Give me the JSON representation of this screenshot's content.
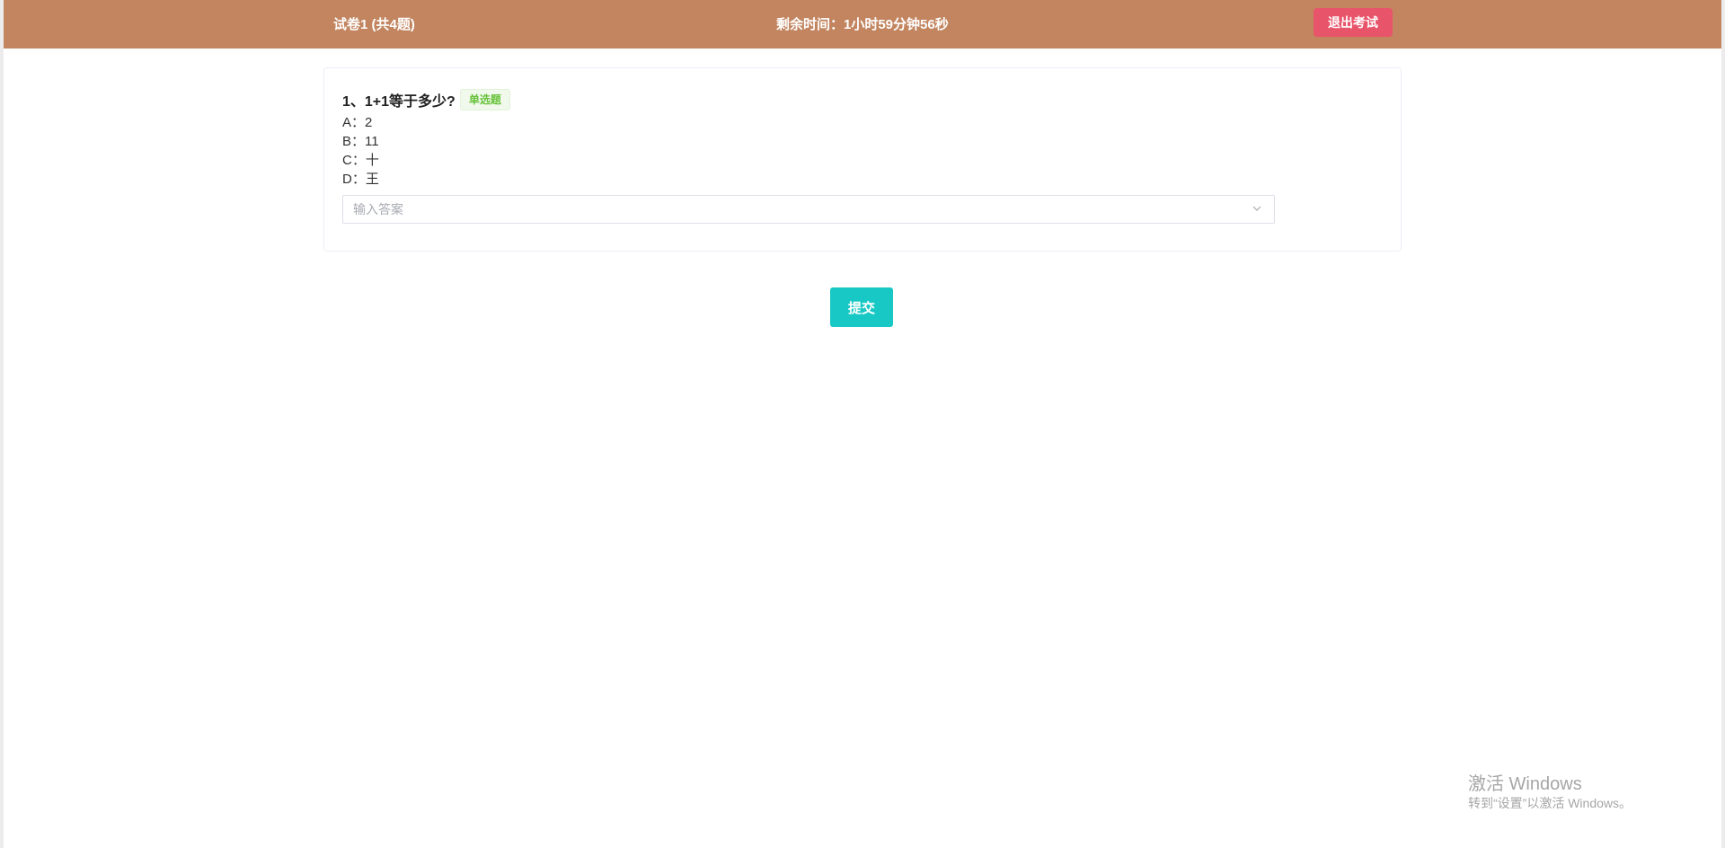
{
  "header": {
    "paper_title": "试卷1 (共4题)",
    "timer_text": "剩余时间：1小时59分钟56秒",
    "exit_label": "退出考试",
    "bg_color": "#c28560",
    "exit_color": "#e8546a"
  },
  "question": {
    "title": "1、1+1等于多少?",
    "type_tag": "单选题",
    "options": [
      {
        "text": "A：2"
      },
      {
        "text": "B：11"
      },
      {
        "text": "C：十"
      },
      {
        "text": "D：王"
      }
    ],
    "answer_value": "",
    "answer_placeholder": "输入答案",
    "dropdown_icon": "chevron-down-icon"
  },
  "submit_label": "提交",
  "submit_color": "#18c8c4",
  "watermark": {
    "title": "激活 Windows",
    "subtitle": "转到“设置”以激活 Windows。"
  }
}
